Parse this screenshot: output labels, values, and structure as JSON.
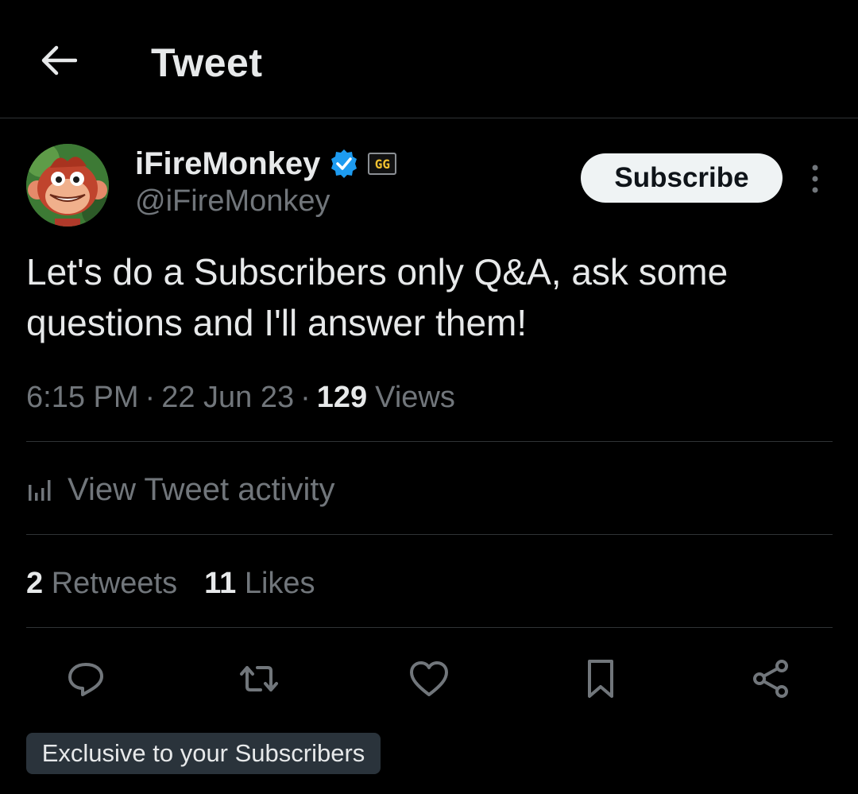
{
  "header": {
    "title": "Tweet",
    "back_icon": "arrow-left-icon"
  },
  "author": {
    "display_name": "iFireMonkey",
    "handle": "@iFireMonkey",
    "verified_icon": "verified-badge-icon",
    "affiliate_badge_text": "GG",
    "avatar_icon": "monkey-avatar"
  },
  "subscribe_label": "Subscribe",
  "tweet": {
    "line1": "Let's do a Subscribers only Q&A, ask some",
    "line2": "questions and I'll answer them!"
  },
  "meta": {
    "time": "6:15 PM",
    "date": "22 Jun 23",
    "separator": "·",
    "views_count": "129",
    "views_label": "Views"
  },
  "activity": {
    "label": "View Tweet activity",
    "icon": "bar-chart-icon"
  },
  "stats": {
    "retweets_count": "2",
    "retweets_label": "Retweets",
    "likes_count": "11",
    "likes_label": "Likes"
  },
  "actions": [
    "reply-icon",
    "retweet-icon",
    "like-icon",
    "bookmark-icon",
    "share-icon"
  ],
  "exclusive_label": "Exclusive to your Subscribers",
  "colors": {
    "background": "#000000",
    "text": "#e7e9ea",
    "secondary": "#71767b",
    "divider": "#2f3336",
    "verified": "#1d9bf0",
    "pill": "#2a333b"
  }
}
